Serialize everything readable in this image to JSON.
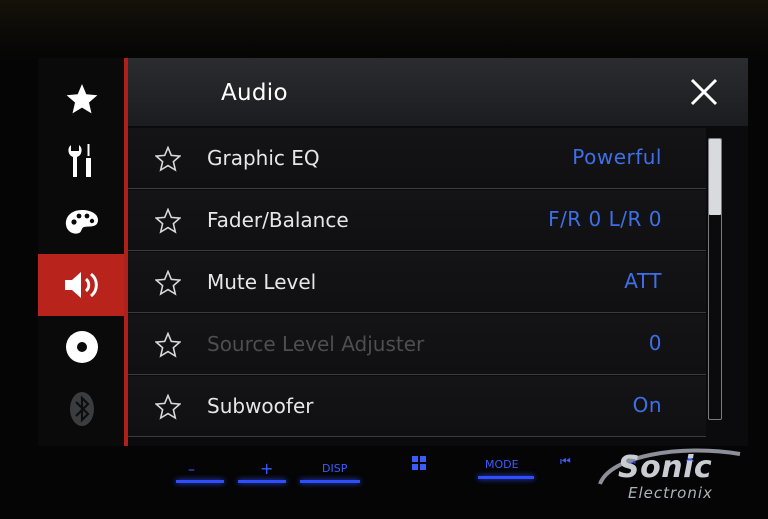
{
  "header": {
    "title": "Audio"
  },
  "sidebar": {
    "items": [
      {
        "icon": "star-icon",
        "active": false
      },
      {
        "icon": "settings-tools-icon",
        "active": false
      },
      {
        "icon": "theme-palette-icon",
        "active": false
      },
      {
        "icon": "speaker-icon",
        "active": true
      },
      {
        "icon": "disc-icon",
        "active": false
      },
      {
        "icon": "bluetooth-icon",
        "active": false
      }
    ]
  },
  "settings": {
    "rows": [
      {
        "label": "Graphic EQ",
        "value": "Powerful",
        "enabled": true
      },
      {
        "label": "Fader/Balance",
        "value": "F/R 0 L/R 0",
        "enabled": true
      },
      {
        "label": "Mute Level",
        "value": "ATT",
        "enabled": true
      },
      {
        "label": "Source Level Adjuster",
        "value": "0",
        "enabled": false
      },
      {
        "label": "Subwoofer",
        "value": "On",
        "enabled": true
      }
    ]
  },
  "scrollbar": {
    "position": 0.0,
    "visible_fraction": 0.27
  },
  "hardware": {
    "minus": "–",
    "plus": "+",
    "disp": "DISP",
    "mode": "MODE",
    "prev": "⏮",
    "next": "⏭",
    "eject": "⏶"
  },
  "watermark": {
    "line1": "Sonic",
    "line2": "Electronix"
  },
  "colors": {
    "accent_red": "#b8231c",
    "value_blue": "#3f6fe6",
    "hw_blue": "#2f4fff"
  }
}
